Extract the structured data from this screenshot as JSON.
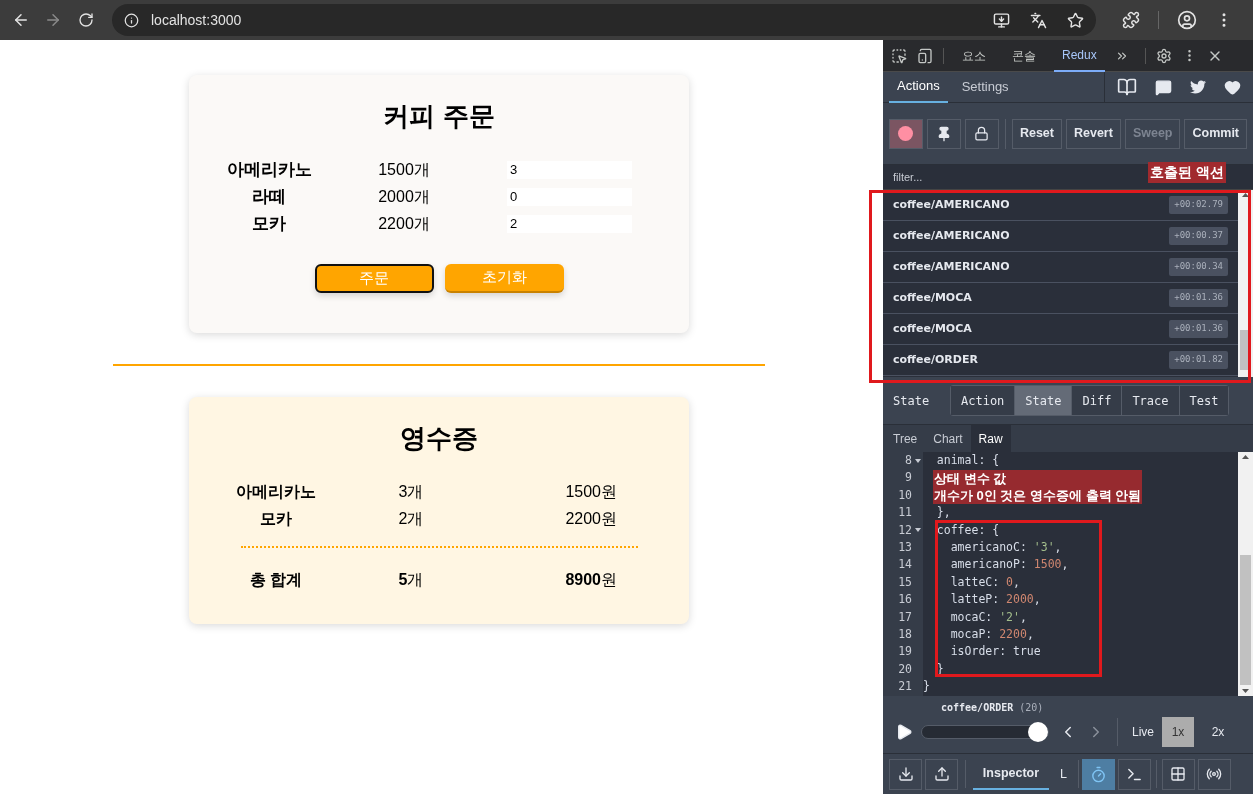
{
  "browser": {
    "url": "localhost:3000"
  },
  "order_card": {
    "title": "커피 주문",
    "items": [
      {
        "name": "아메리카노",
        "price": "1500개",
        "quantity": "3"
      },
      {
        "name": "라떼",
        "price": "2000개",
        "quantity": "0"
      },
      {
        "name": "모카",
        "price": "2200개",
        "quantity": "2"
      }
    ],
    "buttons": [
      {
        "label": "주문",
        "focused": true
      },
      {
        "label": "초기화",
        "focused": false
      }
    ]
  },
  "receipt": {
    "title": "영수증",
    "items": [
      {
        "name": "아메리카노",
        "count": "3개",
        "price": "1500원"
      },
      {
        "name": "모카",
        "count": "2개",
        "price": "2200원"
      }
    ],
    "total": {
      "label": "총 합계",
      "count": "**5**개",
      "price": "**8900**원"
    }
  },
  "devtools": {
    "panel_tabs": [
      {
        "label": "요소",
        "selected": false
      },
      {
        "label": "콘솔",
        "selected": false
      },
      {
        "label": "Redux",
        "selected": true
      }
    ],
    "redux_tabs": [
      {
        "label": "Actions",
        "selected": true
      },
      {
        "label": "Settings",
        "selected": false
      }
    ],
    "recording": true,
    "toolbar": [
      {
        "label": "Reset",
        "disabled": false
      },
      {
        "label": "Revert",
        "disabled": false
      },
      {
        "label": "Sweep",
        "disabled": true
      },
      {
        "label": "Commit",
        "disabled": false
      }
    ],
    "filter": {
      "placeholder": "filter..."
    },
    "actions": [
      {
        "type": "coffee/AMERICANO",
        "time": "+00:02.79"
      },
      {
        "type": "coffee/AMERICANO",
        "time": "+00:00.37"
      },
      {
        "type": "coffee/AMERICANO",
        "time": "+00:00.34"
      },
      {
        "type": "coffee/MOCA",
        "time": "+00:01.36"
      },
      {
        "type": "coffee/MOCA",
        "time": "+00:01.36"
      },
      {
        "type": "coffee/ORDER",
        "time": "+00:01.82"
      }
    ],
    "monitor_label": "State",
    "monitor_tabs": [
      {
        "label": "Action",
        "selected": false
      },
      {
        "label": "State",
        "selected": true
      },
      {
        "label": "Diff",
        "selected": false
      },
      {
        "label": "Trace",
        "selected": false
      },
      {
        "label": "Test",
        "selected": false
      }
    ],
    "view_tabs": [
      {
        "label": "Tree",
        "selected": false
      },
      {
        "label": "Chart",
        "selected": false
      },
      {
        "label": "Raw",
        "selected": true
      }
    ],
    "code_lines": [
      {
        "number": "8",
        "fold": true,
        "tokens": [
          {
            "kind": "key",
            "text": "  animal: {"
          }
        ]
      },
      {
        "number": "9",
        "fold": false
      },
      {
        "number": "10",
        "fold": false
      },
      {
        "number": "11",
        "fold": false,
        "tokens": [
          {
            "kind": "key",
            "text": "  },"
          }
        ]
      },
      {
        "number": "12",
        "fold": true,
        "tokens": [
          {
            "kind": "key",
            "text": "  coffee: {"
          }
        ]
      },
      {
        "number": "13",
        "fold": false,
        "tokens": [
          {
            "kind": "key",
            "text": "    americanoC: "
          },
          {
            "kind": "string",
            "text": "'3'"
          },
          {
            "kind": "key",
            "text": ","
          }
        ]
      },
      {
        "number": "14",
        "fold": false,
        "tokens": [
          {
            "kind": "key",
            "text": "    americanoP: "
          },
          {
            "kind": "number",
            "text": "1500"
          },
          {
            "kind": "key",
            "text": ","
          }
        ]
      },
      {
        "number": "15",
        "fold": false,
        "tokens": [
          {
            "kind": "key",
            "text": "    latteC: "
          },
          {
            "kind": "number",
            "text": "0"
          },
          {
            "kind": "key",
            "text": ","
          }
        ]
      },
      {
        "number": "16",
        "fold": false,
        "tokens": [
          {
            "kind": "key",
            "text": "    latteP: "
          },
          {
            "kind": "number",
            "text": "2000"
          },
          {
            "kind": "key",
            "text": ","
          }
        ]
      },
      {
        "number": "17",
        "fold": false,
        "tokens": [
          {
            "kind": "key",
            "text": "    mocaC: "
          },
          {
            "kind": "string",
            "text": "'2'"
          },
          {
            "kind": "key",
            "text": ","
          }
        ]
      },
      {
        "number": "18",
        "fold": false,
        "tokens": [
          {
            "kind": "key",
            "text": "    mocaP: "
          },
          {
            "kind": "number",
            "text": "2200"
          },
          {
            "kind": "key",
            "text": ","
          }
        ]
      },
      {
        "number": "19",
        "fold": false,
        "tokens": [
          {
            "kind": "key",
            "text": "    isOrder: "
          },
          {
            "kind": "bool",
            "text": "true"
          }
        ]
      },
      {
        "number": "20",
        "fold": false,
        "tokens": [
          {
            "kind": "key",
            "text": "  }"
          }
        ]
      },
      {
        "number": "21",
        "fold": false,
        "tokens": [
          {
            "kind": "key",
            "text": "}"
          }
        ]
      }
    ],
    "slider": {
      "action": "coffee/ORDER",
      "count": "(20)",
      "level": 1
    },
    "live": "Live",
    "speeds": [
      {
        "label": "1x",
        "selected": true
      },
      {
        "label": "2x",
        "selected": false
      }
    ],
    "bottom_tabs": [
      {
        "label": "Inspector",
        "selected": true
      },
      {
        "label": "L",
        "selected": false
      }
    ]
  },
  "annotations": {
    "actions_note": "호출된 액션",
    "state_note": [
      "상태 변수 값",
      "개수가 0인 것은 영수증에 출력 안됨"
    ]
  }
}
